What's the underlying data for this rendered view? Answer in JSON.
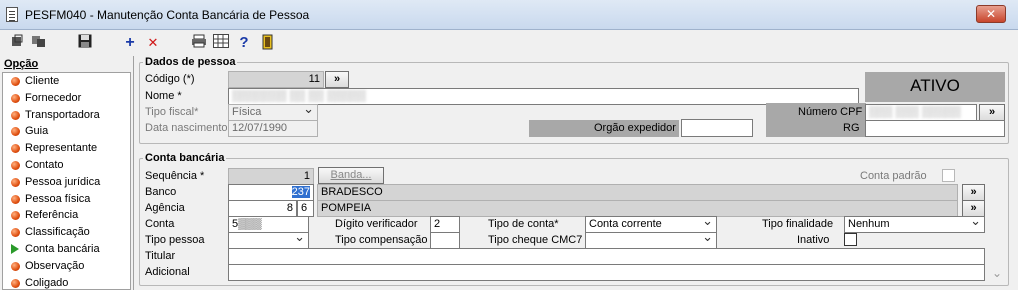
{
  "window": {
    "title": "PESFM040 - Manutenção Conta Bancária de Pessoa",
    "close_label": "✕"
  },
  "toolbar": {
    "icons": [
      "navigate-icon",
      "copy-icon",
      "save-icon",
      "add-icon",
      "delete-icon",
      "print-icon",
      "calculator-icon",
      "help-icon",
      "exit-icon"
    ],
    "add_glyph": "+",
    "delete_glyph": "✕",
    "help_glyph": "?"
  },
  "options": {
    "header": "Opção",
    "items": [
      "Cliente",
      "Fornecedor",
      "Transportadora",
      "Guia",
      "Representante",
      "Contato",
      "Pessoa jurídica",
      "Pessoa física",
      "Referência",
      "Classificação",
      "Conta bancária",
      "Observação",
      "Coligado"
    ],
    "selected": "Conta bancária"
  },
  "dados_pessoa": {
    "title": "Dados de pessoa",
    "codigo_label": "Código (*)",
    "codigo_value": "11",
    "codigo_btn": "»",
    "nome_label": "Nome *",
    "nome_value": "▒▒▒▒▒▒▒ ▒▒ ▒▒ ▒▒▒▒▒",
    "tipo_fiscal_label": "Tipo fiscal*",
    "tipo_fiscal_value": "Física",
    "data_nasc_label": "Data nascimento",
    "data_nasc_value": "12/07/1990",
    "orgao_label": "Orgão expedidor",
    "orgao_value": "",
    "status": "ATIVO",
    "cpf_label": "Número CPF",
    "cpf_value": "▒▒▒ ▒▒▒ ▒▒▒▒▒",
    "cpf_btn": "»",
    "rg_label": "RG",
    "rg_value": ""
  },
  "conta_bancaria": {
    "title": "Conta bancária",
    "sequencia_label": "Sequência *",
    "sequencia_value": "1",
    "banda_btn": "Banda...",
    "conta_padrao_label": "Conta padrão",
    "banco_label": "Banco",
    "banco_code": "237",
    "banco_name": "BRADESCO",
    "banco_btn": "»",
    "agencia_label": "Agência",
    "agencia_num": "8",
    "agencia_dig": "6",
    "agencia_name": "POMPEIA",
    "agencia_btn": "»",
    "conta_label": "Conta",
    "conta_value": "5▒▒▒",
    "digito_label": "Dígito verificador",
    "digito_value": "2",
    "tipo_conta_label": "Tipo de conta*",
    "tipo_conta_value": "Conta corrente",
    "tipo_finalidade_label": "Tipo finalidade",
    "tipo_finalidade_value": "Nenhum",
    "tipo_pessoa_label": "Tipo pessoa",
    "tipo_pessoa_value": "",
    "tipo_comp_label": "Tipo compensação",
    "tipo_comp_value": "",
    "tipo_cheque_label": "Tipo cheque CMC7",
    "tipo_cheque_value": "",
    "inativo_label": "Inativo",
    "titular_label": "Titular",
    "titular_value": "",
    "adicional_label": "Adicional",
    "adicional_value": ""
  },
  "colors": {
    "status_bg": "#a8a8a8",
    "selected_arrow": "#2a9a2a",
    "option_dot": "#e05010",
    "close_btn": "#c8452c"
  }
}
